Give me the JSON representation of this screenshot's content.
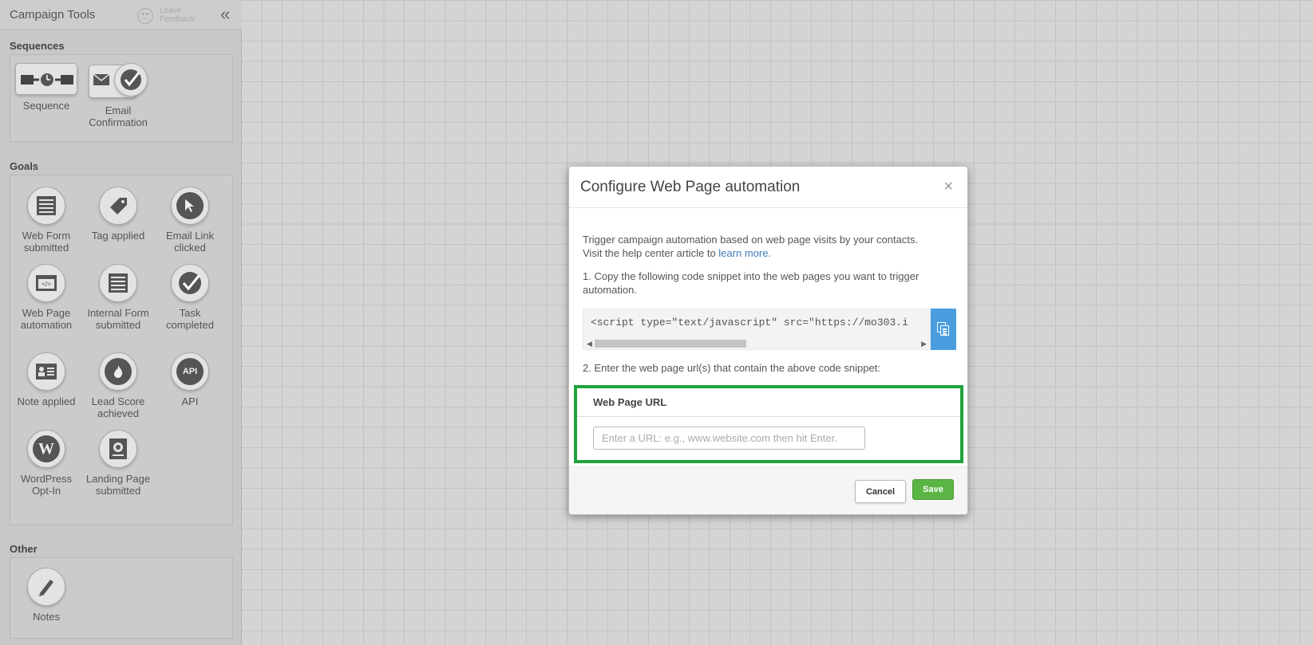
{
  "sidebar": {
    "title": "Campaign Tools",
    "feedback_label": "Leave Feedback",
    "collapse_glyph": "«",
    "sections": {
      "sequences": {
        "label": "Sequences",
        "tools": [
          {
            "label": "Sequence",
            "icon": "sequence-icon"
          },
          {
            "label": "Email Confirmation",
            "icon": "email-confirmation-icon"
          }
        ]
      },
      "goals": {
        "label": "Goals",
        "tools": [
          {
            "label": "Web Form submitted",
            "icon": "web-form-icon"
          },
          {
            "label": "Tag applied",
            "icon": "tag-icon"
          },
          {
            "label": "Email Link clicked",
            "icon": "cursor-icon"
          },
          {
            "label": "Web Page automation",
            "icon": "web-page-code-icon"
          },
          {
            "label": "Internal Form submitted",
            "icon": "internal-form-icon"
          },
          {
            "label": "Task completed",
            "icon": "task-check-icon"
          },
          {
            "label": "Note applied",
            "icon": "note-card-icon"
          },
          {
            "label": "Lead Score achieved",
            "icon": "flame-icon"
          },
          {
            "label": "API",
            "icon": "api-icon"
          },
          {
            "label": "WordPress Opt-In",
            "icon": "wordpress-icon"
          },
          {
            "label": "Landing Page submitted",
            "icon": "landing-page-icon"
          }
        ]
      },
      "other": {
        "label": "Other",
        "tools": [
          {
            "label": "Notes",
            "icon": "pencil-icon"
          }
        ]
      }
    }
  },
  "modal": {
    "title": "Configure Web Page automation",
    "close_glyph": "×",
    "description_line1": "Trigger campaign automation based on web page visits by your contacts.",
    "description_line2_prefix": "Visit the help center article to ",
    "learn_more_link": "learn more.",
    "step1_text": "1. Copy the following code snippet into the web pages you want to trigger automation.",
    "code_snippet": "<script type=\"text/javascript\" src=\"https://mo303.i",
    "step2_text": "2. Enter the web page url(s) that contain the above code snippet:",
    "url_panel": {
      "header": "Web Page URL",
      "input_value": "",
      "input_placeholder": "Enter a URL: e.g., www.website.com then hit Enter."
    },
    "cancel_label": "Cancel",
    "save_label": "Save"
  },
  "colors": {
    "highlight_border": "#1fa33d",
    "save_button": "#5bb544",
    "copy_button": "#4a9ee0",
    "link": "#3d7ab8"
  }
}
